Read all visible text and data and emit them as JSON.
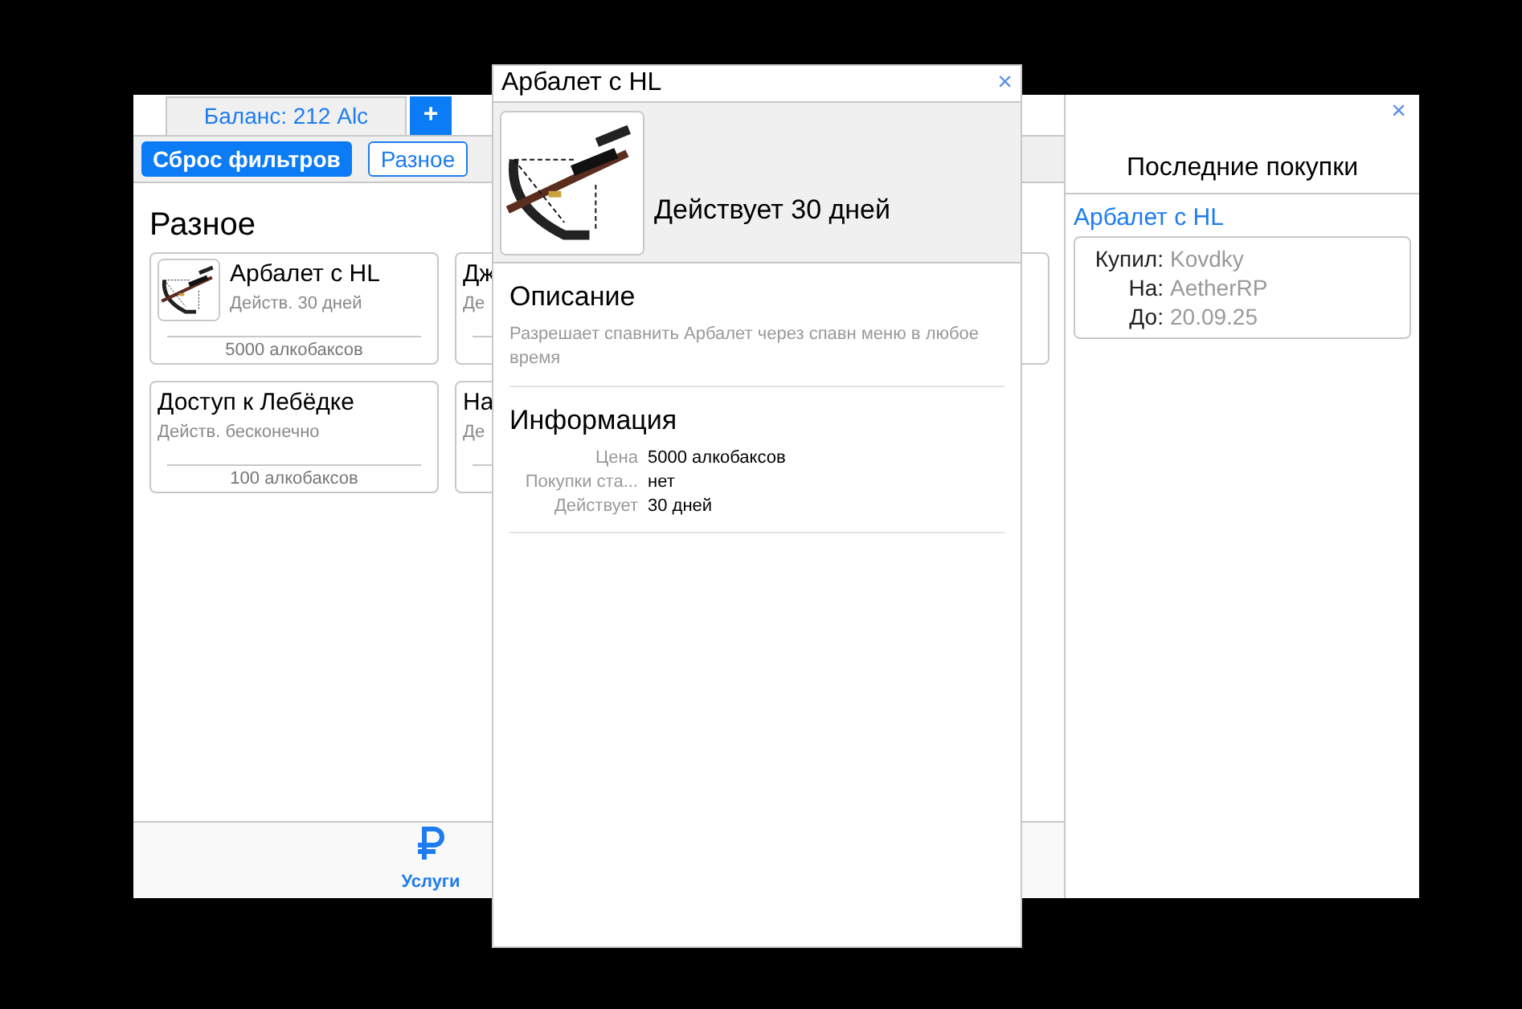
{
  "shop": {
    "balance_tab": "Баланс: 212 Alc",
    "add_button": "+",
    "filters": [
      {
        "label": "Сброс фильтров",
        "selected": true
      },
      {
        "label": "Разное",
        "selected": false
      }
    ],
    "category": "Разное",
    "items": [
      {
        "title": "Арбалет с HL",
        "duration": "Действ. 30 дней",
        "price": "5000 алкобаксов",
        "kind": "picture"
      },
      {
        "title": "Дж",
        "duration": "Де",
        "kind": "plain"
      },
      {
        "kind": "hidden"
      },
      {
        "title": "Доступ к Лебёдке",
        "duration": "Действ. бесконечно",
        "price": "100 алкобаксов",
        "kind": "plain"
      },
      {
        "title": "На",
        "duration": "Де",
        "kind": "plain"
      }
    ],
    "nav": [
      {
        "label": "Услуги",
        "selected": true
      }
    ],
    "recent": {
      "title": "Последние покупки",
      "item": "Арбалет с HL",
      "rows": [
        {
          "label": "Купил:",
          "value": "Kovdky"
        },
        {
          "label": "На:",
          "value": "AetherRP"
        },
        {
          "label": "До:",
          "value": "20.09.25"
        }
      ]
    }
  },
  "dialog": {
    "title": "Арбалет с HL",
    "close": "×",
    "duration": "Действует 30 дней",
    "description_heading": "Описание",
    "description": "Разрешает спавнить Арбалет через спавн меню в любое время",
    "info_heading": "Информация",
    "info": [
      {
        "label": "Цена",
        "value": "5000 алкобаксов"
      },
      {
        "label": "Покупки ста...",
        "value": "нет"
      },
      {
        "label": "Действует",
        "value": "30 дней"
      }
    ]
  },
  "main_close": "×"
}
